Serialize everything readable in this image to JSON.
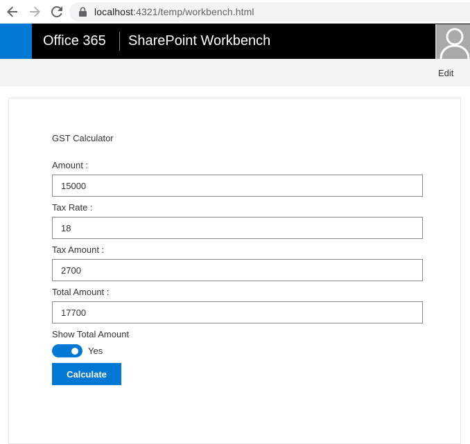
{
  "browser": {
    "url_host": "localhost",
    "url_rest": ":4321/temp/workbench.html",
    "back_icon": "arrow-left-icon",
    "forward_icon": "arrow-right-icon",
    "reload_icon": "reload-icon",
    "lock_icon": "lock-icon"
  },
  "suite_bar": {
    "brand": "Office 365",
    "app_title": "SharePoint Workbench",
    "waffle_color": "#0078d4",
    "avatar_icon": "user-avatar-icon"
  },
  "command_bar": {
    "edit_label": "Edit"
  },
  "webpart": {
    "title": "GST Calculator",
    "fields": [
      {
        "label": "Amount :",
        "value": "15000"
      },
      {
        "label": "Tax Rate :",
        "value": "18"
      },
      {
        "label": "Tax Amount :",
        "value": "2700"
      },
      {
        "label": "Total Amount :",
        "value": "17700"
      }
    ],
    "toggle": {
      "label": "Show Total Amount",
      "state_text": "Yes",
      "on": true
    },
    "calculate_label": "Calculate",
    "accent_color": "#0078d4"
  }
}
